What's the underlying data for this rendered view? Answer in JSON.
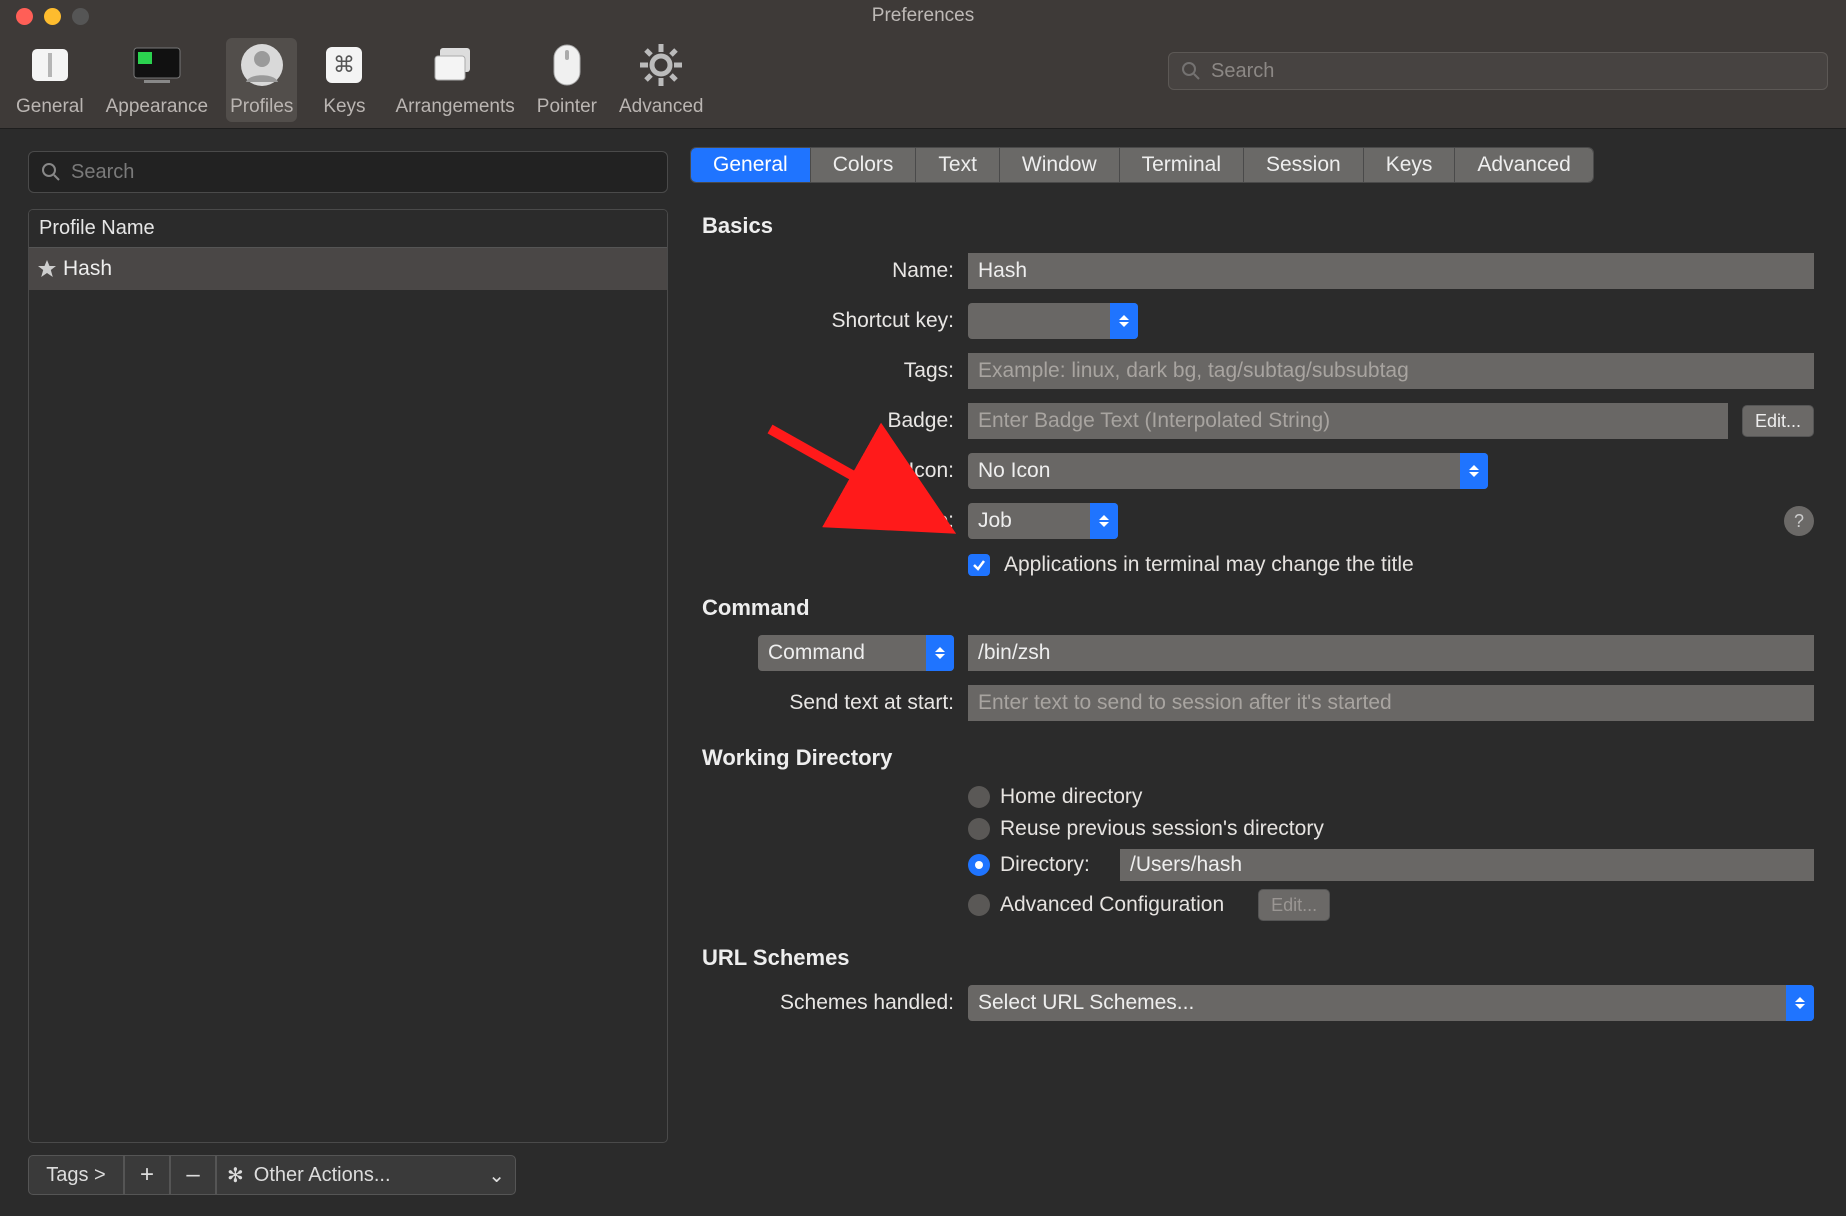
{
  "window": {
    "title": "Preferences"
  },
  "toolbar": {
    "items": [
      {
        "id": "general",
        "label": "General"
      },
      {
        "id": "appearance",
        "label": "Appearance"
      },
      {
        "id": "profiles",
        "label": "Profiles"
      },
      {
        "id": "keys",
        "label": "Keys"
      },
      {
        "id": "arrangements",
        "label": "Arrangements"
      },
      {
        "id": "pointer",
        "label": "Pointer"
      },
      {
        "id": "advanced",
        "label": "Advanced"
      }
    ],
    "search_placeholder": "Search"
  },
  "sidebar": {
    "search_placeholder": "Search",
    "header": "Profile Name",
    "items": [
      {
        "name": "Hash",
        "default": true
      }
    ],
    "bottombar": {
      "tags": "Tags >",
      "add": "+",
      "remove": "–",
      "other_actions": "Other Actions..."
    }
  },
  "tabs": [
    "General",
    "Colors",
    "Text",
    "Window",
    "Terminal",
    "Session",
    "Keys",
    "Advanced"
  ],
  "basics": {
    "heading": "Basics",
    "name_label": "Name:",
    "name_value": "Hash",
    "shortcut_label": "Shortcut key:",
    "shortcut_value": "",
    "tags_label": "Tags:",
    "tags_placeholder": "Example: linux, dark bg, tag/subtag/subsubtag",
    "badge_label": "Badge:",
    "badge_placeholder": "Enter Badge Text (Interpolated String)",
    "badge_edit": "Edit...",
    "icon_label": "Icon:",
    "icon_value": "No Icon",
    "title_label": "Title:",
    "title_value": "Job",
    "apps_may_change": "Applications in terminal may change the title"
  },
  "command": {
    "heading": "Command",
    "mode": "Command",
    "value": "/bin/zsh",
    "send_label": "Send text at start:",
    "send_placeholder": "Enter text to send to session after it's started"
  },
  "workdir": {
    "heading": "Working Directory",
    "opt_home": "Home directory",
    "opt_reuse": "Reuse previous session's directory",
    "opt_dir": "Directory:",
    "dir_value": "/Users/hash",
    "opt_adv": "Advanced Configuration",
    "adv_edit": "Edit..."
  },
  "url": {
    "heading": "URL Schemes",
    "label": "Schemes handled:",
    "value": "Select URL Schemes..."
  }
}
